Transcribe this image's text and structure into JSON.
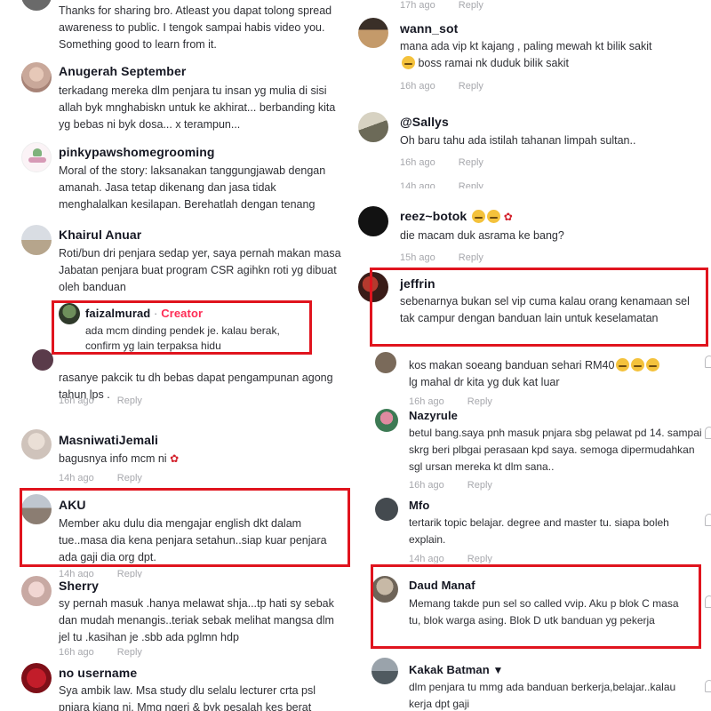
{
  "left": {
    "comments": [
      {
        "text": "Thanks for sharing bro. Atleast you dapat tolong spread awareness to public. I tengok sampai habis video you. Something good to learn from it."
      },
      {
        "user": "Anugerah September",
        "text": "terkadang mereka dlm penjara tu insan yg mulia di sisi allah byk mnghabiskn untuk ke akhirat... berbanding kita yg bebas ni byk dosa... x terampun..."
      },
      {
        "user": "pinkypawshomegrooming",
        "text": "Moral of the story: laksanakan tanggungjawab dengan amanah. Jasa tetap dikenang dan jasa tidak menghalalkan kesilapan. Berehatlah dengan tenang"
      },
      {
        "user": "Khairul Anuar",
        "text": "Roti/bun dri penjara sedap yer, saya pernah makan masa Jabatan penjara buat program CSR agihkn roti yg dibuat oleh banduan"
      },
      {
        "user": "faizalmurad",
        "creator_sep": " · ",
        "creator": "Creator",
        "text": "ada mcm dinding pendek je. kalau berak, confirm yg lain terpaksa hidu"
      },
      {
        "text": "rasanye pakcik tu dh bebas dapat pengampunan agong tahun lps .",
        "time": "16h ago",
        "reply": "Reply"
      },
      {
        "user": "MasniwatiJemali",
        "text": "bagusnya info mcm ni",
        "time": "14h ago",
        "reply": "Reply"
      },
      {
        "user": "AKU",
        "text": "Member aku dulu dia mengajar english dkt dalam tue..masa dia kena penjara setahun..siap kuar penjara ada gaji dia org dpt.",
        "time": "14h ago",
        "reply": "Reply"
      },
      {
        "user": "Sherry",
        "text": "sy pernah masuk .hanya melawat shja...tp hati sy sebak dan mudah menangis..teriak sebak melihat mangsa dlm jel tu .kasihan je .sbb ada pglmn hdp",
        "time": "16h ago",
        "reply": "Reply"
      },
      {
        "user": "no username",
        "text": "Sya ambik law. Msa study dlu selalu lecturer crta psl pnjara kjang ni. Mmg ngeri & byk pesalah kes berat"
      }
    ]
  },
  "right": {
    "comments": [
      {
        "time": "17h ago",
        "reply": "Reply"
      },
      {
        "user": "wann_sot",
        "text": "mana ada vip kt kajang , paling mewah kt bilik sakit",
        "text2": " boss ramai nk duduk bilik sakit",
        "time": "16h ago",
        "reply": "Reply"
      },
      {
        "user": "@Sallys",
        "text": "Oh baru tahu ada istilah tahanan limpah sultan..",
        "time": "16h ago",
        "reply": "Reply"
      },
      {
        "time": "14h ago",
        "reply": "Reply"
      },
      {
        "user": "reez~botok",
        "text": "die macam duk asrama ke bang?",
        "time": "15h ago",
        "reply": "Reply"
      },
      {
        "user": "jeffrin",
        "text": "sebenarnya bukan sel vip cuma kalau orang kenamaan sel tak campur dengan banduan lain untuk keselamatan"
      },
      {
        "text": "kos makan soeang banduan sehari RM40",
        "text2": "lg mahal dr kita yg duk kat luar",
        "time": "16h ago",
        "reply": "Reply"
      },
      {
        "user": "Nazyrule",
        "text": "betul bang.saya pnh masuk pnjara sbg pelawat pd 14. sampai skrg beri plbgai perasaan kpd saya. semoga dipermudahkan sgl ursan mereka kt dlm sana..",
        "time": "16h ago",
        "reply": "Reply"
      },
      {
        "user": "Mfo",
        "text": "tertarik topic belajar. degree and master tu. siapa boleh explain.",
        "time": "14h ago",
        "reply": "Reply"
      },
      {
        "user": "Daud Manaf",
        "text": "Memang takde pun sel so called vvip. Aku p blok C masa tu, blok warga asing. Blok D utk banduan yg pekerja"
      },
      {
        "user": "Kakak Batman",
        "text": "dlm penjara tu mmg ada banduan berkerja,belajar..kalau kerja dpt gaji"
      }
    ]
  },
  "colors": {
    "highlight": "#e0141e",
    "creator": "#fe2c55",
    "meta": "#a7a8ad"
  }
}
